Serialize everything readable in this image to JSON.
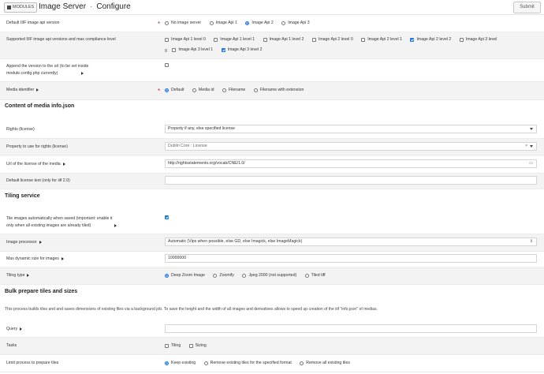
{
  "header": {
    "modules_label": "MODULES",
    "title": "Image Server",
    "subtitle": "Configure",
    "submit_label": "Submit"
  },
  "fields": {
    "iiif_version": {
      "label": "Default IIIF image api version",
      "options": [
        "No image server",
        "Image Api 1",
        "Image Api 2",
        "Image Api 3"
      ],
      "selected": "Image Api 2"
    },
    "compliance": {
      "label": "Supported IIIF image api versions and max compliance level",
      "options_line1": [
        "Image Api 1 level 0",
        "Image Api 1 level 1",
        "Image Api 1 level 2",
        "Image Api 2 level 0",
        "Image Api 2 level 1",
        "Image Api 2 level 2",
        "Image Api 3 level"
      ],
      "options_line2_prefix": "0",
      "options_line2": [
        "Image Api 3 level 1",
        "Image Api 3 level 2"
      ],
      "checked": [
        "Image Api 2 level 2",
        "Image Api 3 level 2"
      ]
    },
    "append_version": {
      "label_line1": "Append the version to the url (to be set inside",
      "label_line2": "module.config.php currently)",
      "checked": false
    },
    "media_identifier": {
      "label": "Media identifier",
      "options": [
        "Default",
        "Media id",
        "Filename",
        "Filename with extension"
      ],
      "selected": "Default"
    }
  },
  "section_media_info": {
    "title": "Content of media info.json",
    "rights_label": "Rights (license)",
    "rights_value": "Property if any, else specified license",
    "rights_property_label": "Property to use for rights (license)",
    "rights_property_value": "Dublin Core : License",
    "rights_property_clear": "×",
    "license_url_label": "Url of the license of the media",
    "license_url_value": "http://rightsstatements.org/vocab/CNE/1.0/",
    "license_text_label": "Default license text (only for iiif 2.0)",
    "license_text_value": ""
  },
  "section_tiling": {
    "title": "Tiling service",
    "auto_tile_label_line1": "Tile images automatically when saved (important: enable it",
    "auto_tile_label_line2": "only when all existing images are already tiled)",
    "auto_tile_checked": true,
    "processor_label": "Image processor",
    "processor_value": "Automatic (Vips when possible, else GD, else Imagick, else ImageMagick)",
    "max_size_label": "Max dynamic size for images",
    "max_size_value": "10000000",
    "tiling_type_label": "Tiling type",
    "tiling_type_options": [
      "Deep Zoom Image",
      "Zoomify",
      "Jpeg 2000 (not supported)",
      "Tiled tiff"
    ],
    "tiling_type_selected": "Deep Zoom Image"
  },
  "section_bulk": {
    "title": "Bulk prepare tiles and sizes",
    "description": "This process builds tiles and and saves dimensions of existing files via a background job. To save the height and the width of all images and derivatives allows to speed up creation of the iiif \"info.json\" of medias.",
    "query_label": "Query",
    "query_value": "",
    "tasks_label": "Tasks",
    "tasks_options": [
      "Tiling",
      "Sizing"
    ],
    "limit_label": "Limit process to prepare tiles",
    "limit_options": [
      "Keep existing",
      "Remove existing tiles for the specified format",
      "Remove all existing tiles"
    ],
    "limit_selected": "Keep existing"
  },
  "colors": {
    "accent": "#1a73e8",
    "required": "#c62828",
    "row_alt": "#f3f3f3"
  }
}
